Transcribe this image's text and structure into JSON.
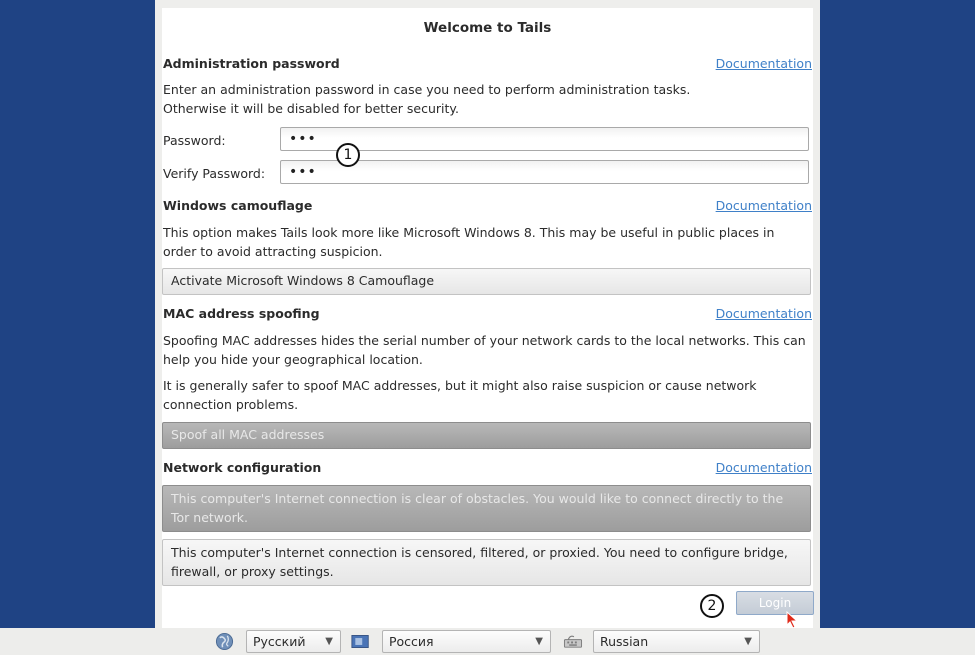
{
  "window": {
    "title": "Welcome to Tails"
  },
  "admin": {
    "heading": "Administration password",
    "doc_link": "Documentation",
    "description_1": "Enter an administration password in case you need to perform administration tasks.",
    "description_2": "Otherwise it will be disabled for better security.",
    "password_label": "Password:",
    "password_value": "•••",
    "verify_label": "Verify Password:",
    "verify_value": "•••"
  },
  "camouflage": {
    "heading": "Windows camouflage",
    "doc_link": "Documentation",
    "description": "This option makes Tails look more like Microsoft Windows 8. This may be useful in public places in order to avoid attracting suspicion.",
    "button_label": "Activate Microsoft Windows 8 Camouflage"
  },
  "mac": {
    "heading": "MAC address spoofing",
    "doc_link": "Documentation",
    "description_1": "Spoofing MAC addresses hides the serial number of your network cards to the local networks. This can help you hide your geographical location.",
    "description_2": "It is generally safer to spoof MAC addresses, but it might also raise suspicion or cause network connection problems.",
    "button_label": "Spoof all MAC addresses"
  },
  "network": {
    "heading": "Network configuration",
    "doc_link": "Documentation",
    "option_direct": "This computer's Internet connection is clear of obstacles. You would like to connect directly to the Tor network.",
    "option_censored": "This computer's Internet connection is censored, filtered, or proxied. You need to configure bridge, firewall, or proxy settings."
  },
  "login": {
    "label": "Login"
  },
  "annotations": {
    "marker_1": "1",
    "marker_2": "2"
  },
  "bottom_bar": {
    "language": "Русский",
    "region": "Россия",
    "keyboard": "Russian",
    "globe_icon": "globe-icon",
    "flag_icon": "flag-icon",
    "keyboard_icon": "keyboard-icon"
  },
  "colors": {
    "background": "#1f4384",
    "link": "#3f80c8",
    "selected_option": "#9d9d9d"
  }
}
